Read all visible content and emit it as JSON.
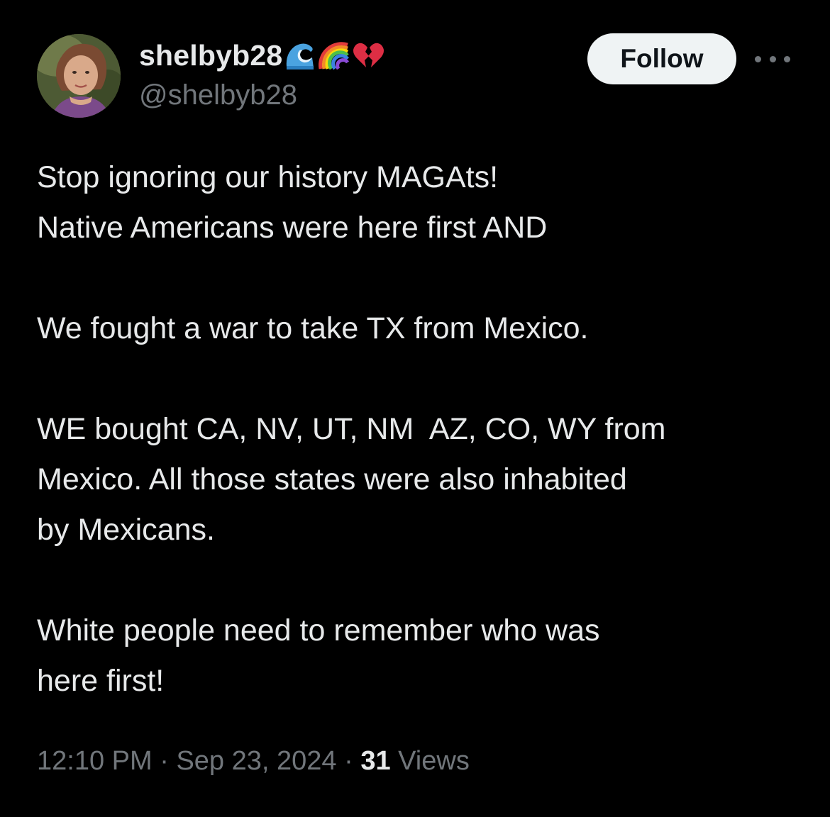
{
  "user": {
    "display_name": "shelbyb28",
    "handle": "@shelbyb28",
    "name_emojis": [
      "wave-emoji",
      "rainbow-emoji",
      "broken-heart-emoji"
    ]
  },
  "actions": {
    "follow_label": "Follow",
    "more_icon": "more-horizontal-icon"
  },
  "tweet": {
    "paragraphs": [
      [
        "Stop ignoring our history MAGAts!",
        "Native Americans were here first AND"
      ],
      [
        "We fought a war to take TX from Mexico."
      ],
      [
        "WE bought CA, NV, UT, NM  AZ, CO, WY from",
        "Mexico. All those states were also inhabited",
        "by Mexicans."
      ],
      [
        "White people need to remember who was",
        "here first!"
      ]
    ]
  },
  "meta": {
    "time": "12:10 PM",
    "separator": " · ",
    "date": "Sep 23, 2024",
    "views_count": "31",
    "views_label": " Views"
  },
  "colors": {
    "background": "#000000",
    "text_primary": "#e7e9ea",
    "text_secondary": "#71767b",
    "follow_bg": "#eff3f4",
    "follow_text": "#0f1419"
  }
}
